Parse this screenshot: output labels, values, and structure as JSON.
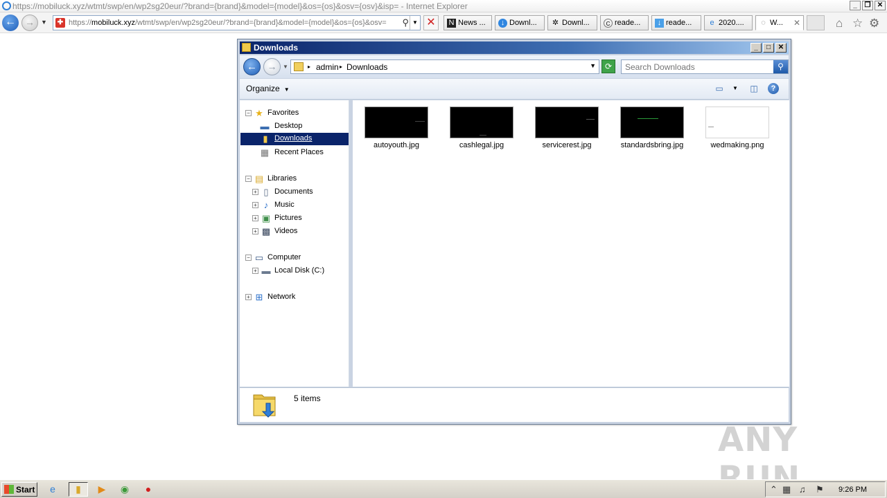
{
  "browser": {
    "window_title": "https://mobiluck.xyz/wtmt/swp/en/wp2sg20eur/?brand={brand}&model={model}&os={os}&osv={osv}&isp= - Internet Explorer",
    "url_prefix": "https://",
    "url_domain": "mobiluck.xyz",
    "url_path": "/wtmt/swp/en/wp2sg20eur/?brand={brand}&model={model}&os={os}&osv=",
    "tabs": [
      {
        "label": "News ...",
        "icon": "news-icon"
      },
      {
        "label": "Downl...",
        "icon": "download-icon"
      },
      {
        "label": "Downl...",
        "icon": "gear-icon"
      },
      {
        "label": "reade...",
        "icon": "reader-icon"
      },
      {
        "label": "reade...",
        "icon": "download-icon"
      },
      {
        "label": "2020....",
        "icon": "ie-icon"
      },
      {
        "label": "W...",
        "icon": "loading-icon"
      }
    ]
  },
  "explorer": {
    "title": "Downloads",
    "breadcrumb": [
      "admin",
      "Downloads"
    ],
    "search_placeholder": "Search Downloads",
    "organize_label": "Organize",
    "nav": {
      "favorites": "Favorites",
      "desktop": "Desktop",
      "downloads": "Downloads",
      "recent_places": "Recent Places",
      "libraries": "Libraries",
      "documents": "Documents",
      "music": "Music",
      "pictures": "Pictures",
      "videos": "Videos",
      "computer": "Computer",
      "local_disk": "Local Disk (C:)",
      "network": "Network"
    },
    "files": [
      {
        "name": "autoyouth.jpg",
        "thumb": "dark"
      },
      {
        "name": "cashlegal.jpg",
        "thumb": "dark"
      },
      {
        "name": "servicerest.jpg",
        "thumb": "dark"
      },
      {
        "name": "standardsbring.jpg",
        "thumb": "dark"
      },
      {
        "name": "wedmaking.png",
        "thumb": "light"
      }
    ],
    "item_count": "5 items"
  },
  "taskbar": {
    "start_label": "Start",
    "clock": "9:26 PM"
  },
  "watermark": "ANY RUN",
  "colors": {
    "selection": "#0a246a",
    "titlebar": "#0a246a",
    "accent": "#1f5eb6"
  }
}
